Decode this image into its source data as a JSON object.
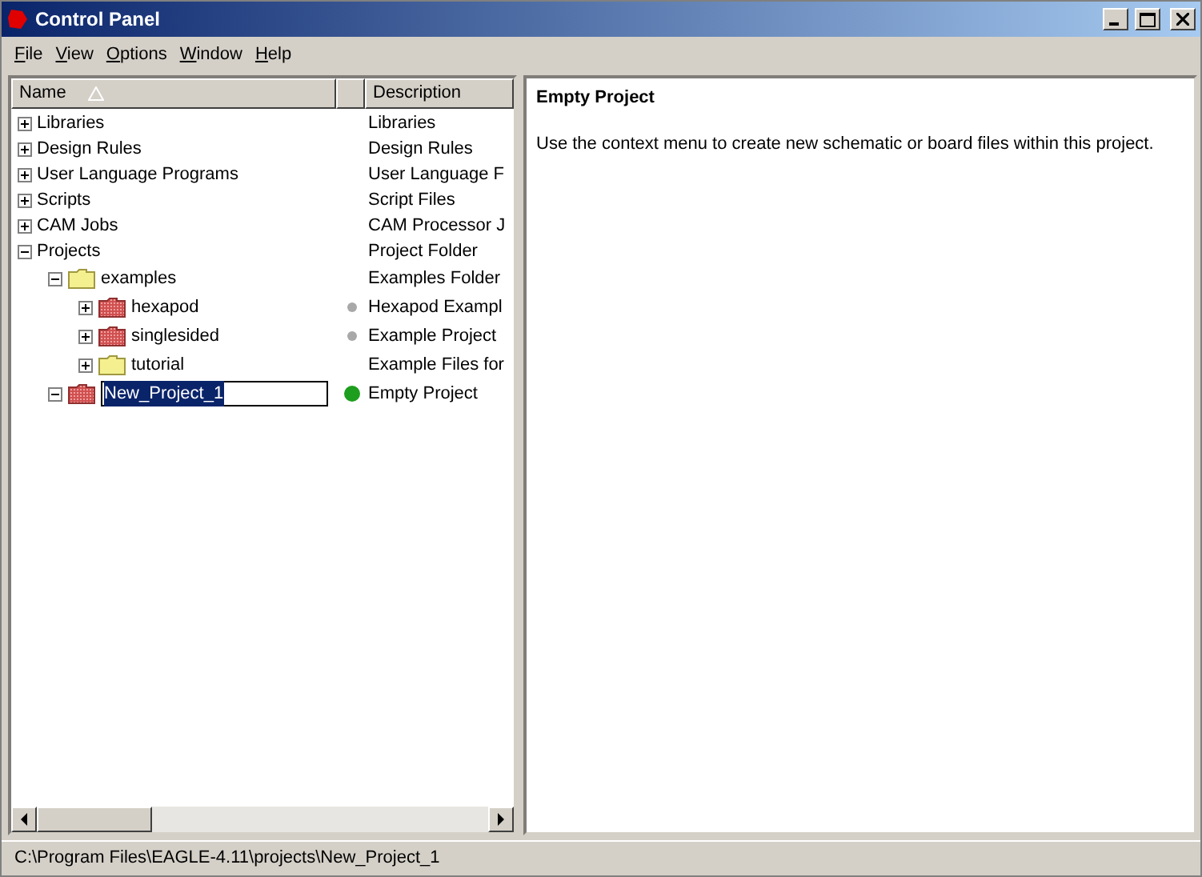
{
  "window": {
    "title": "Control Panel"
  },
  "menu": [
    "File",
    "View",
    "Options",
    "Window",
    "Help"
  ],
  "tree": {
    "columns": [
      "Name",
      "Description"
    ],
    "items": [
      {
        "name": "Libraries",
        "description": "Libraries",
        "expanded": false,
        "selected": false
      },
      {
        "name": "Design Rules",
        "description": "Design Rules",
        "expanded": false,
        "selected": false
      },
      {
        "name": "User Language Programs",
        "description": "User Language F",
        "expanded": false,
        "selected": false
      },
      {
        "name": "Scripts",
        "description": "Script Files",
        "expanded": false,
        "selected": false
      },
      {
        "name": "CAM Jobs",
        "description": "CAM Processor J",
        "expanded": false,
        "selected": false
      },
      {
        "name": "Projects",
        "description": "Project Folder",
        "expanded": true,
        "selected": false,
        "children": [
          {
            "name": "examples",
            "description": "Examples Folder",
            "expanded": true,
            "kind": "folder",
            "selected": false,
            "children": [
              {
                "name": "hexapod",
                "description": "Hexapod Exampl",
                "expanded": false,
                "kind": "project",
                "selected": false,
                "color": "#a8a8a8"
              },
              {
                "name": "singlesided",
                "description": "Example Project",
                "expanded": false,
                "kind": "project",
                "selected": false,
                "color": "#a8a8a8"
              },
              {
                "name": "tutorial",
                "description": "Example Files for",
                "expanded": false,
                "kind": "folder",
                "selected": false
              }
            ]
          },
          {
            "name": "New_Project_1",
            "description": "Empty Project",
            "expanded": true,
            "kind": "project",
            "selected": true,
            "color": "#1e9e1e"
          }
        ]
      }
    ]
  },
  "detail": {
    "title": "Empty Project",
    "text": "Use the context menu to create new schematic or board files within this project."
  },
  "status_bar": "C:\\Program Files\\EAGLE-4.11\\projects\\New_Project_1"
}
